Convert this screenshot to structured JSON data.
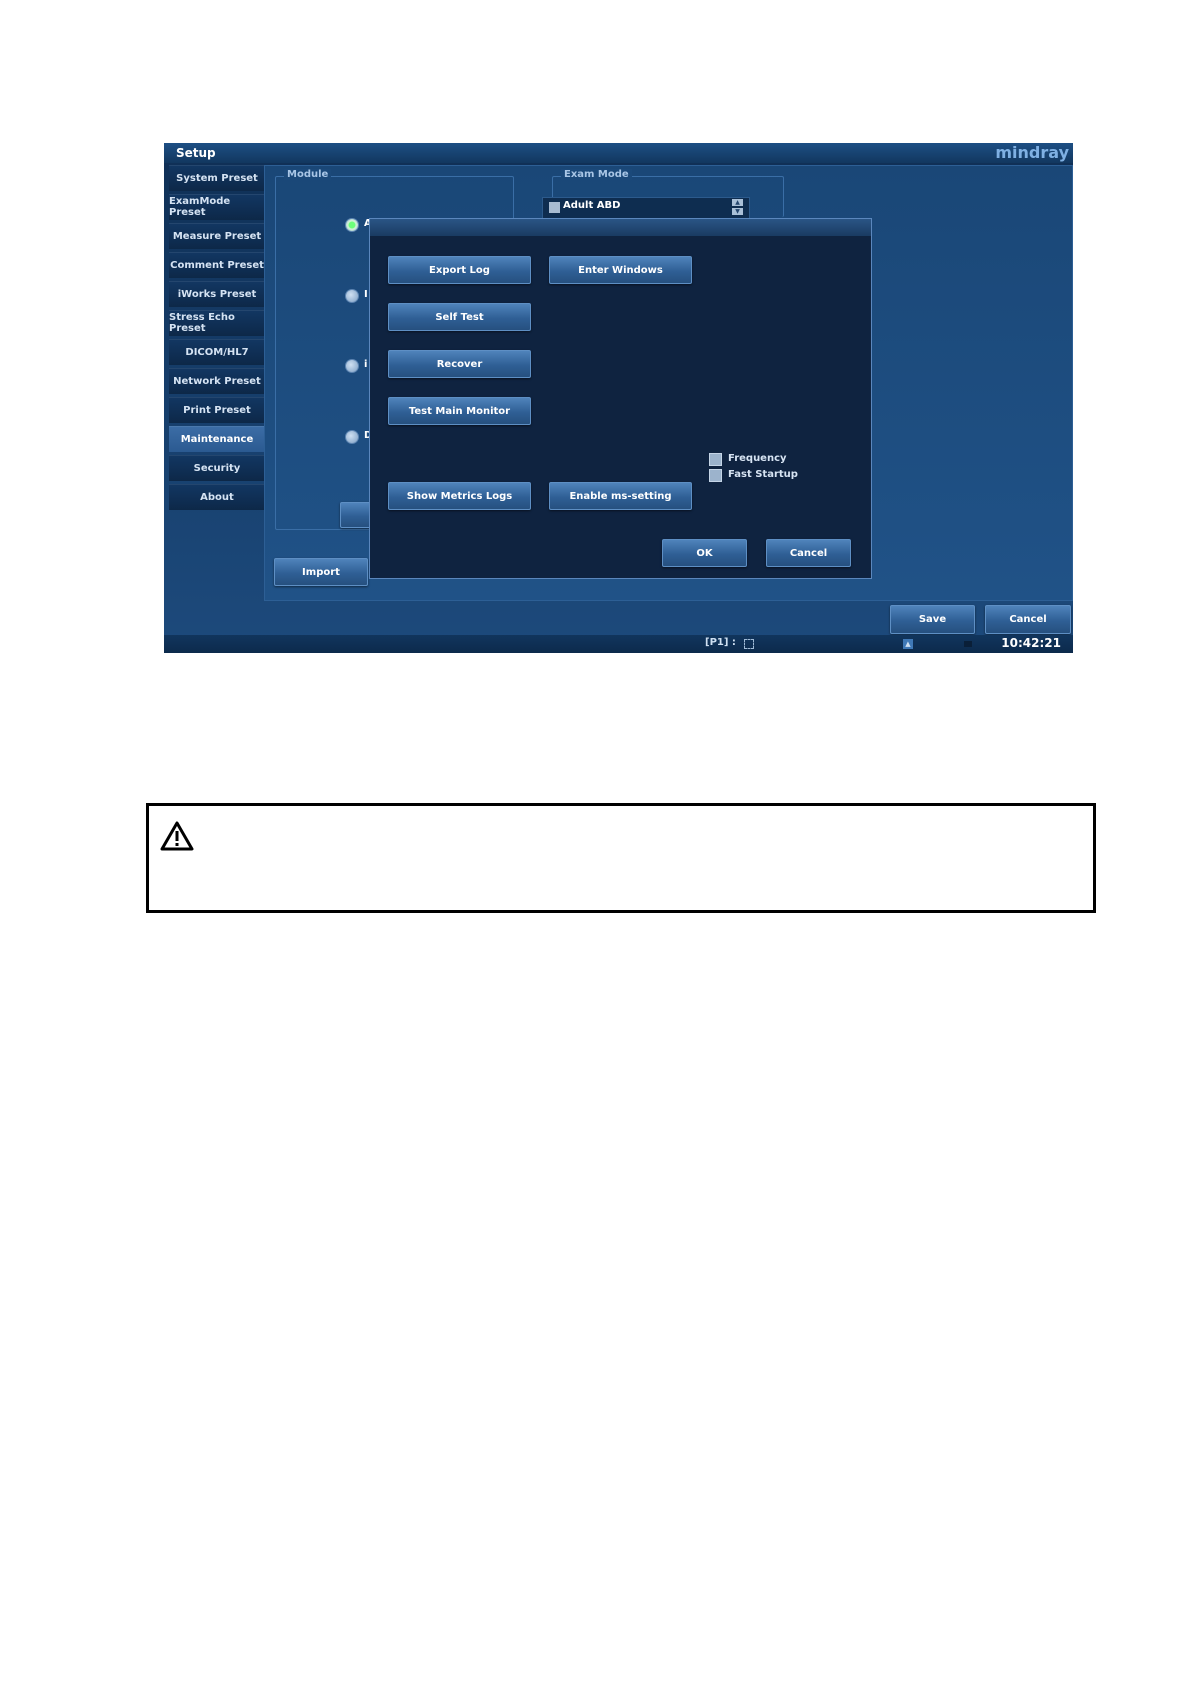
{
  "window": {
    "title": "Setup",
    "brand": "mindray"
  },
  "sidebar": {
    "items": [
      {
        "label": "System Preset"
      },
      {
        "label": "ExamMode Preset"
      },
      {
        "label": "Measure Preset"
      },
      {
        "label": "Comment Preset"
      },
      {
        "label": "iWorks Preset"
      },
      {
        "label": "Stress Echo Preset"
      },
      {
        "label": "DICOM/HL7"
      },
      {
        "label": "Network Preset"
      },
      {
        "label": "Print Preset"
      },
      {
        "label": "Maintenance"
      },
      {
        "label": "Security"
      },
      {
        "label": "About"
      }
    ],
    "active": "Maintenance"
  },
  "main": {
    "module_group": {
      "title": "Module",
      "partial_labels": [
        "A",
        "I",
        "i",
        "D"
      ]
    },
    "exam_mode_group": {
      "title": "Exam Mode",
      "first_item": "Adult ABD"
    },
    "import_label": "Import"
  },
  "dialog": {
    "buttons": {
      "export_log": "Export Log",
      "enter_windows": "Enter Windows",
      "self_test": "Self Test",
      "recover": "Recover",
      "test_main_monitor": "Test Main Monitor",
      "show_metrics_logs": "Show Metrics Logs",
      "enable_ms_setting": "Enable ms-setting",
      "ok": "OK",
      "cancel": "Cancel"
    },
    "checkboxes": {
      "frequency": "Frequency",
      "fast_startup": "Fast Startup"
    }
  },
  "footer": {
    "save": "Save",
    "cancel": "Cancel"
  },
  "statusbar": {
    "probe": "[P1] :",
    "time": "10:42:21"
  },
  "colors": {
    "accent": "#5e8fc4",
    "background": "#163e6b",
    "radio_on": "#6cff7a"
  }
}
